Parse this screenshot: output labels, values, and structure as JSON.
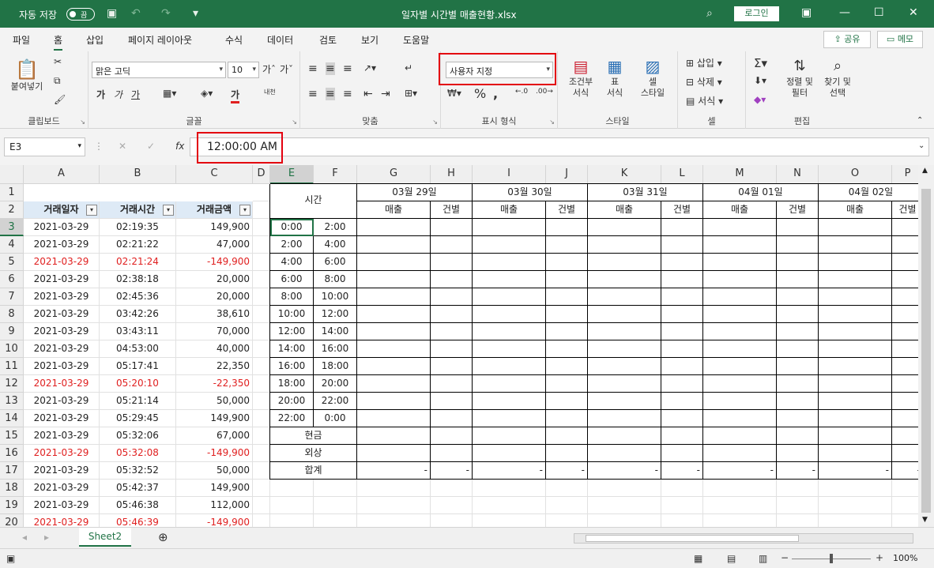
{
  "title": {
    "autosave_label": "자동 저장",
    "autosave_state": "끔",
    "doc_name": "일자별 시간별 매출현황.xlsx",
    "login": "로그인"
  },
  "tabs": [
    "파일",
    "홈",
    "삽입",
    "페이지 레이아웃",
    "수식",
    "데이터",
    "검토",
    "보기",
    "도움말"
  ],
  "share": "공유",
  "memo": "메모",
  "ribbon": {
    "paste": "붙여넣기",
    "clipboard": "클립보드",
    "font_name": "맑은 고딕",
    "font_size": "10",
    "font_group": "글꼴",
    "align_group": "맞춤",
    "number_format": "사용자 지정",
    "number_group": "표시 형식",
    "cond_format_1": "조건부",
    "cond_format_2": "서식",
    "table_1": "표",
    "table_2": "서식",
    "cellstyle_1": "셀",
    "cellstyle_2": "스타일",
    "style_group": "스타일",
    "insert": "삽입",
    "delete": "삭제",
    "format": "서식",
    "cell_group": "셀",
    "sort_1": "정렬 및",
    "sort_2": "필터",
    "find_1": "찾기 및",
    "find_2": "선택",
    "edit_group": "편집",
    "bold": "가",
    "italic": "가",
    "underline": "가",
    "font_color": "가",
    "wrap": "내천"
  },
  "formula_bar": {
    "name_box": "E3",
    "value": "12:00:00 AM"
  },
  "columns": [
    "A",
    "B",
    "C",
    "D",
    "E",
    "F",
    "G",
    "H",
    "I",
    "J",
    "K",
    "L",
    "M",
    "N",
    "O",
    "P"
  ],
  "rows": [
    "1",
    "2",
    "3",
    "4",
    "5",
    "6",
    "7",
    "8",
    "9",
    "10",
    "11",
    "12",
    "13",
    "14",
    "15",
    "16",
    "17",
    "18",
    "19",
    "20"
  ],
  "table_headers": [
    "거래일자",
    "거래시간",
    "거래금액"
  ],
  "transactions": [
    {
      "date": "2021-03-29",
      "time": "02:19:35",
      "amount": "149,900",
      "neg": false
    },
    {
      "date": "2021-03-29",
      "time": "02:21:22",
      "amount": "47,000",
      "neg": false
    },
    {
      "date": "2021-03-29",
      "time": "02:21:24",
      "amount": "-149,900",
      "neg": true
    },
    {
      "date": "2021-03-29",
      "time": "02:38:18",
      "amount": "20,000",
      "neg": false
    },
    {
      "date": "2021-03-29",
      "time": "02:45:36",
      "amount": "20,000",
      "neg": false
    },
    {
      "date": "2021-03-29",
      "time": "03:42:26",
      "amount": "38,610",
      "neg": false
    },
    {
      "date": "2021-03-29",
      "time": "03:43:11",
      "amount": "70,000",
      "neg": false
    },
    {
      "date": "2021-03-29",
      "time": "04:53:00",
      "amount": "40,000",
      "neg": false
    },
    {
      "date": "2021-03-29",
      "time": "05:17:41",
      "amount": "22,350",
      "neg": false
    },
    {
      "date": "2021-03-29",
      "time": "05:20:10",
      "amount": "-22,350",
      "neg": true
    },
    {
      "date": "2021-03-29",
      "time": "05:21:14",
      "amount": "50,000",
      "neg": false
    },
    {
      "date": "2021-03-29",
      "time": "05:29:45",
      "amount": "149,900",
      "neg": false
    },
    {
      "date": "2021-03-29",
      "time": "05:32:06",
      "amount": "67,000",
      "neg": false
    },
    {
      "date": "2021-03-29",
      "time": "05:32:08",
      "amount": "-149,900",
      "neg": true
    },
    {
      "date": "2021-03-29",
      "time": "05:32:52",
      "amount": "50,000",
      "neg": false
    },
    {
      "date": "2021-03-29",
      "time": "05:42:37",
      "amount": "149,900",
      "neg": false
    },
    {
      "date": "2021-03-29",
      "time": "05:46:38",
      "amount": "112,000",
      "neg": false
    },
    {
      "date": "2021-03-29",
      "time": "05:46:39",
      "amount": "-149,900",
      "neg": true
    }
  ],
  "summary": {
    "time_header": "시간",
    "dates": [
      "03월 29일",
      "03월 30일",
      "03월 31일",
      "04월 01일",
      "04월 02일"
    ],
    "sales": "매출",
    "count": "건별",
    "time_slots": [
      [
        "0:00",
        "2:00"
      ],
      [
        "2:00",
        "4:00"
      ],
      [
        "4:00",
        "6:00"
      ],
      [
        "6:00",
        "8:00"
      ],
      [
        "8:00",
        "10:00"
      ],
      [
        "10:00",
        "12:00"
      ],
      [
        "12:00",
        "14:00"
      ],
      [
        "14:00",
        "16:00"
      ],
      [
        "16:00",
        "18:00"
      ],
      [
        "18:00",
        "20:00"
      ],
      [
        "20:00",
        "22:00"
      ],
      [
        "22:00",
        "0:00"
      ]
    ],
    "cash": "현금",
    "credit": "외상",
    "total": "합계",
    "dash": "-"
  },
  "sheet_tab": "Sheet2",
  "zoom": "100%",
  "colors": {
    "accent": "#217346",
    "header_fill": "#deeaf6",
    "negative": "#e02020",
    "highlight": "#e3000f"
  }
}
